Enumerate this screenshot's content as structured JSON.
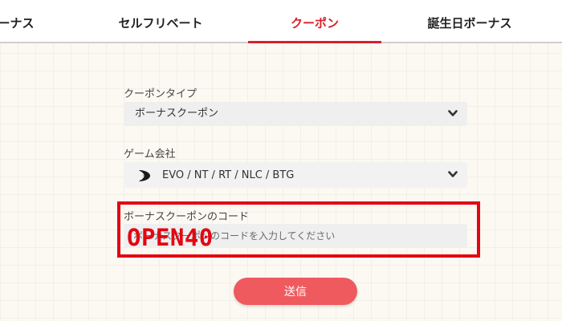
{
  "tabs": [
    {
      "label": "ーナス",
      "active": false
    },
    {
      "label": "セルフリベート",
      "active": false
    },
    {
      "label": "クーポン",
      "active": true
    },
    {
      "label": "誕生日ボーナス",
      "active": false
    }
  ],
  "form": {
    "coupon_type": {
      "label": "クーポンタイプ",
      "value": "ボーナスクーポン"
    },
    "game_provider": {
      "label": "ゲーム会社",
      "value": "EVO / NT / RT / NLC / BTG"
    },
    "coupon_code": {
      "label": "ボーナスクーポンのコード",
      "placeholder": "ボーナスクーポンのコードを入力してください",
      "overlay_code": "OPEN40"
    },
    "submit_label": "送信"
  },
  "colors": {
    "accent": "#d8202c",
    "highlight_box": "#e30613",
    "submit_button": "#ef5a5f"
  },
  "icons": {
    "dropdown": "chevron-down-icon",
    "provider_logo": "evo-logo-icon"
  }
}
